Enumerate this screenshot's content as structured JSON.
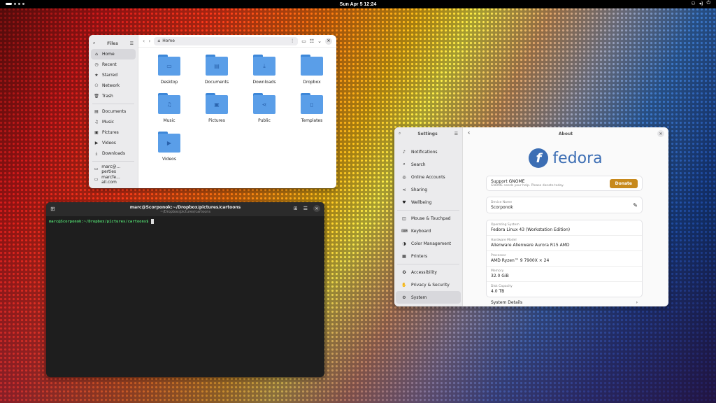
{
  "topbar": {
    "clock": "Sun Apr 5  12:24",
    "tray_icons": [
      "network-icon",
      "volume-icon",
      "power-icon"
    ]
  },
  "files": {
    "sidebar_title": "Files",
    "nav": [
      {
        "icon": "home-icon",
        "label": "Home",
        "active": true
      },
      {
        "icon": "clock-icon",
        "label": "Recent"
      },
      {
        "icon": "star-icon",
        "label": "Starred"
      },
      {
        "icon": "network-icon",
        "label": "Network"
      },
      {
        "icon": "trash-icon",
        "label": "Trash"
      }
    ],
    "places": [
      {
        "icon": "document-icon",
        "label": "Documents"
      },
      {
        "icon": "music-icon",
        "label": "Music"
      },
      {
        "icon": "picture-icon",
        "label": "Pictures"
      },
      {
        "icon": "video-icon",
        "label": "Videos"
      },
      {
        "icon": "download-icon",
        "label": "Downloads"
      }
    ],
    "remote": [
      {
        "icon": "drive-icon",
        "label": "marc@... perties"
      },
      {
        "icon": "drive-icon",
        "label": "marcfe... ail.com"
      }
    ],
    "path": "Home",
    "folders": [
      {
        "label": "Desktop",
        "glyph": "▭"
      },
      {
        "label": "Documents",
        "glyph": "▤"
      },
      {
        "label": "Downloads",
        "glyph": "⤓"
      },
      {
        "label": "Dropbox",
        "glyph": ""
      },
      {
        "label": "Music",
        "glyph": "♫"
      },
      {
        "label": "Pictures",
        "glyph": "▣"
      },
      {
        "label": "Public",
        "glyph": "⋖"
      },
      {
        "label": "Templates",
        "glyph": "▯"
      },
      {
        "label": "Videos",
        "glyph": "▶"
      }
    ]
  },
  "terminal": {
    "title": "marc@Scorponok:~/Dropbox/pictures/cartoons",
    "subtitle": "~/Dropbox/pictures/cartoons",
    "prompt": "marc@Scorponok:~/Dropbox/pictures/cartoons$"
  },
  "settings": {
    "sidebar_title": "Settings",
    "items_a": [
      {
        "icon": "bell-icon",
        "label": "Notifications"
      },
      {
        "icon": "search-icon",
        "label": "Search"
      },
      {
        "icon": "accounts-icon",
        "label": "Online Accounts"
      },
      {
        "icon": "share-icon",
        "label": "Sharing"
      },
      {
        "icon": "wellbeing-icon",
        "label": "Wellbeing"
      }
    ],
    "items_b": [
      {
        "icon": "mouse-icon",
        "label": "Mouse & Touchpad"
      },
      {
        "icon": "keyboard-icon",
        "label": "Keyboard"
      },
      {
        "icon": "color-icon",
        "label": "Color Management"
      },
      {
        "icon": "printer-icon",
        "label": "Printers"
      }
    ],
    "items_c": [
      {
        "icon": "accessibility-icon",
        "label": "Accessibility"
      },
      {
        "icon": "privacy-icon",
        "label": "Privacy & Security"
      },
      {
        "icon": "gear-icon",
        "label": "System",
        "active": true
      }
    ],
    "page_title": "About",
    "logo_word": "fedora",
    "support_title": "Support GNOME",
    "support_sub": "GNOME needs your help. Please donate today.",
    "donate_label": "Donate",
    "device_name_label": "Device Name",
    "device_name": "Scorponok",
    "info": [
      {
        "k": "Operating System",
        "v": "Fedora Linux 43 (Workstation Edition)"
      },
      {
        "k": "Hardware Model",
        "v": "Alienware Alienware Aurora R15 AMD"
      },
      {
        "k": "Processor",
        "v": "AMD Ryzen™ 9 7900X × 24"
      },
      {
        "k": "Memory",
        "v": "32.0 GiB"
      },
      {
        "k": "Disk Capacity",
        "v": "4.0 TB"
      }
    ],
    "details_label": "System Details"
  }
}
